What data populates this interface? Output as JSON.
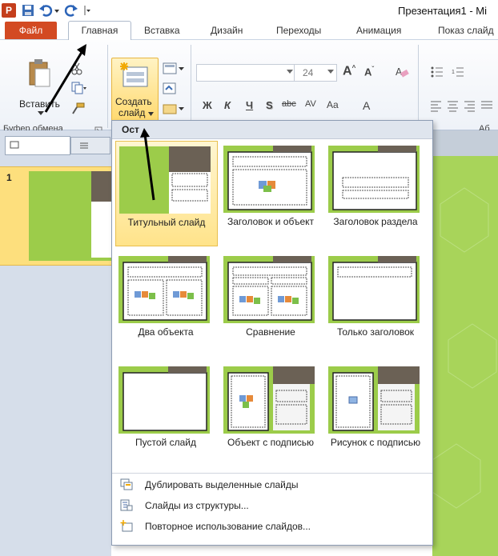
{
  "window": {
    "title": "Презентация1 - Mi"
  },
  "tabs": [
    {
      "label": "Файл"
    },
    {
      "label": "Главная"
    },
    {
      "label": "Вставка"
    },
    {
      "label": "Дизайн"
    },
    {
      "label": "Переходы"
    },
    {
      "label": "Анимация"
    },
    {
      "label": "Показ слайд"
    }
  ],
  "ribbon": {
    "paste_label": "Вставить",
    "new_slide_label_line1": "Создать",
    "new_slide_label_line2": "слайд",
    "clipboard_group": "Буфер обмена",
    "font_size": "24",
    "font_group_partial": "Аб"
  },
  "slide_panel": {
    "slide_number": "1"
  },
  "dropdown": {
    "header": "Ост",
    "layouts": [
      {
        "label": "Титульный слайд"
      },
      {
        "label": "Заголовок и объект"
      },
      {
        "label": "Заголовок раздела"
      },
      {
        "label": "Два объекта"
      },
      {
        "label": "Сравнение"
      },
      {
        "label": "Только заголовок"
      },
      {
        "label": "Пустой слайд"
      },
      {
        "label": "Объект с подписью"
      },
      {
        "label": "Рисунок с подписью"
      }
    ],
    "menu": [
      {
        "label": "Дублировать выделенные слайды"
      },
      {
        "label": "Слайды из структуры..."
      },
      {
        "label": "Повторное использование слайдов..."
      }
    ]
  },
  "colors": {
    "file_tab": "#d34a22",
    "thumb_green": "#9ccc4a",
    "thumb_dark": "#6b6155",
    "selected_bg": "#ffe38a"
  }
}
